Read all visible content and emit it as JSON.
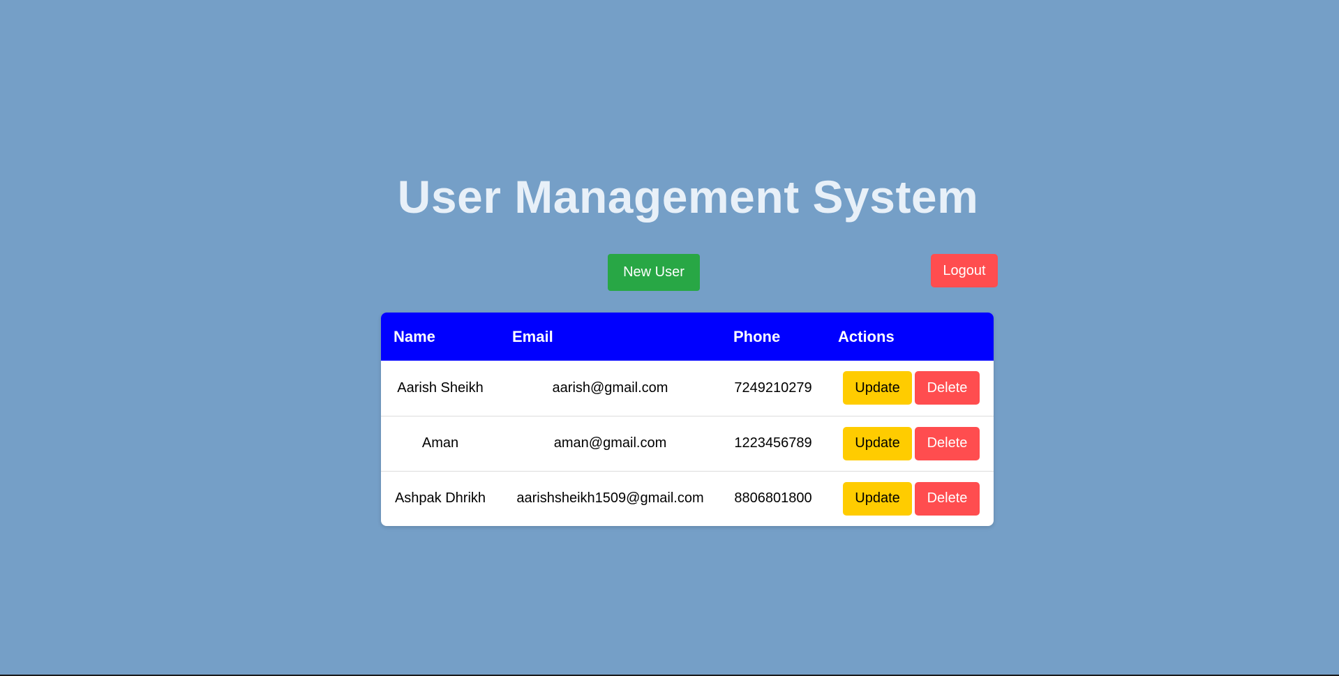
{
  "header": {
    "title": "User Management System"
  },
  "toolbar": {
    "new_user_label": "New User",
    "logout_label": "Logout"
  },
  "table": {
    "columns": [
      "Name",
      "Email",
      "Phone",
      "Actions"
    ],
    "rows": [
      {
        "name": "Aarish Sheikh",
        "email": "aarish@gmail.com",
        "phone": "7249210279",
        "update_label": "Update",
        "delete_label": "Delete"
      },
      {
        "name": "Aman",
        "email": "aman@gmail.com",
        "phone": "1223456789",
        "update_label": "Update",
        "delete_label": "Delete"
      },
      {
        "name": "Ashpak Dhrikh",
        "email": "aarishsheikh1509@gmail.com",
        "phone": "8806801800",
        "update_label": "Update",
        "delete_label": "Delete"
      }
    ]
  },
  "colors": {
    "background": "#759fc7",
    "header_bg": "#0000ff",
    "new_user": "#28a745",
    "logout": "#ff4d4f",
    "update": "#ffcc00",
    "delete": "#ff4d4f"
  }
}
